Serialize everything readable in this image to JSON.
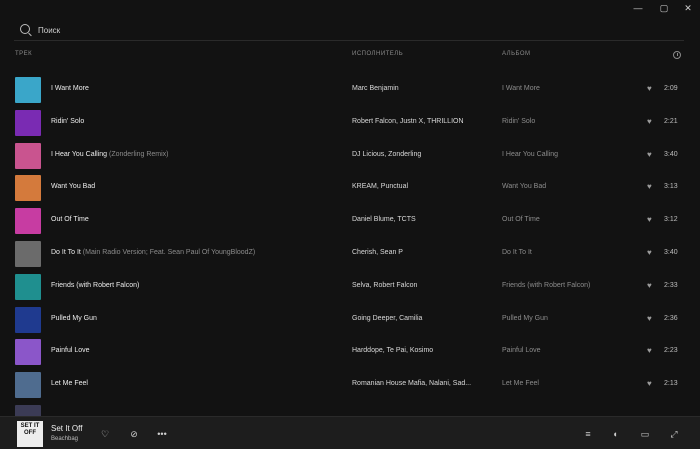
{
  "window_controls": {
    "minimize": "—",
    "maximize": "▢",
    "close": "✕"
  },
  "search": {
    "placeholder": "Поиск"
  },
  "header": {
    "track": "ТРЕК",
    "artist": "ИСПОЛНИТЕЛЬ",
    "album": "АЛЬБОМ",
    "duration_icon": "clock-icon"
  },
  "tracks": [
    {
      "title": "I Want More",
      "subtitle": "",
      "artist": "Marc Benjamin",
      "album": "I Want More",
      "duration": "2:09",
      "color": "#3aa6c9"
    },
    {
      "title": "Ridin' Solo",
      "subtitle": "",
      "artist": "Robert Falcon, Justn X, THRILLION",
      "album": "Ridin' Solo",
      "duration": "2:21",
      "color": "#7a2bb3"
    },
    {
      "title": "I Hear You Calling",
      "subtitle": "(Zonderling Remix)",
      "artist": "DJ Licious, Zonderling",
      "album": "I Hear You Calling",
      "duration": "3:40",
      "color": "#c9548f"
    },
    {
      "title": "Want You Bad",
      "subtitle": "",
      "artist": "KREAM, Punctual",
      "album": "Want You Bad",
      "duration": "3:13",
      "color": "#d47a3c"
    },
    {
      "title": "Out Of Time",
      "subtitle": "",
      "artist": "Daniel Blume, TCTS",
      "album": "Out Of Time",
      "duration": "3:12",
      "color": "#c73ca2"
    },
    {
      "title": "Do It To It",
      "subtitle": "(Main Radio Version; Feat. Sean Paul Of YoungBloodZ)",
      "artist": "Cherish, Sean P",
      "album": "Do It To It",
      "duration": "3:40",
      "color": "#6b6b6b"
    },
    {
      "title": "Friends (with Robert Falcon)",
      "subtitle": "",
      "artist": "Selva, Robert Falcon",
      "album": "Friends (with Robert Falcon)",
      "duration": "2:33",
      "color": "#1f8f8f"
    },
    {
      "title": "Pulled My Gun",
      "subtitle": "",
      "artist": "Going Deeper, Camilia",
      "album": "Pulled My Gun",
      "duration": "2:36",
      "color": "#1f3a8f"
    },
    {
      "title": "Painful Love",
      "subtitle": "",
      "artist": "Harddope, Te Pai, Kosimo",
      "album": "Painful Love",
      "duration": "2:23",
      "color": "#8b56c9"
    },
    {
      "title": "Let Me Feel",
      "subtitle": "",
      "artist": "Romanian House Mafia, Nalani, Sad...",
      "album": "Let Me Feel",
      "duration": "2:13",
      "color": "#4f6c8f"
    },
    {
      "title": "",
      "subtitle": "",
      "artist": "",
      "album": "",
      "duration": "",
      "color": "#3b3b55"
    }
  ],
  "now_playing": {
    "title": "Set It Off",
    "artist": "Beachbag",
    "cover_text": "SET IT OFF",
    "heart_icon": "heart-icon",
    "dislike_icon": "dislike-icon",
    "more_label": "•••"
  },
  "player_controls": {
    "queue": "≡",
    "volume": "◖",
    "miniplayer": "▭",
    "fullscreen": "⤢"
  }
}
